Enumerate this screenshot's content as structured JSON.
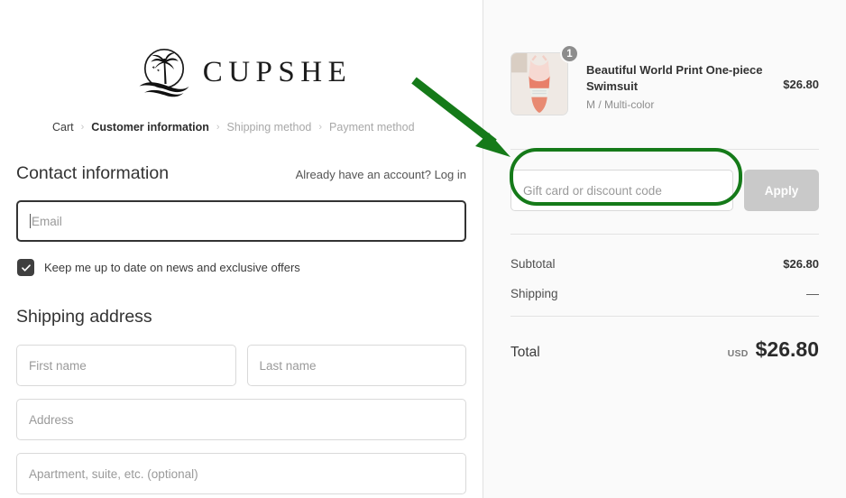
{
  "brand": {
    "name": "CUPSHE",
    "logo_icon": "palm-tree-island-icon"
  },
  "breadcrumb": {
    "items": [
      {
        "label": "Cart",
        "state": "link"
      },
      {
        "label": "Customer information",
        "state": "current"
      },
      {
        "label": "Shipping method",
        "state": "upcoming"
      },
      {
        "label": "Payment method",
        "state": "upcoming"
      }
    ],
    "separator": "›"
  },
  "contact": {
    "title": "Contact information",
    "account_prompt": "Already have an account?",
    "login_label": "Log in",
    "email": {
      "value": "",
      "placeholder": "Email",
      "focused": true
    },
    "newsletter": {
      "label": "Keep me up to date on news and exclusive offers",
      "checked": true,
      "icon": "checkmark-icon"
    }
  },
  "shipping_address": {
    "title": "Shipping address",
    "fields": [
      {
        "name": "first-name",
        "value": "",
        "placeholder": "First name"
      },
      {
        "name": "last-name",
        "value": "",
        "placeholder": "Last name"
      },
      {
        "name": "address",
        "value": "",
        "placeholder": "Address"
      },
      {
        "name": "apartment",
        "value": "",
        "placeholder": "Apartment, suite, etc. (optional)"
      }
    ]
  },
  "order_summary": {
    "product": {
      "title": "Beautiful World Print One-piece Swimsuit",
      "variant": "M / Multi-color",
      "price": "$26.80",
      "quantity": "1",
      "image_icon": "swimsuit-thumbnail"
    },
    "discount": {
      "input_value": "",
      "input_placeholder": "Gift card or discount code",
      "apply_label": "Apply",
      "apply_disabled": true
    },
    "lines": [
      {
        "label": "Subtotal",
        "value": "$26.80"
      },
      {
        "label": "Shipping",
        "value": "—"
      }
    ],
    "total": {
      "label": "Total",
      "currency": "USD",
      "amount": "$26.80"
    }
  },
  "annotation": {
    "color": "#157a19",
    "arrow": "arrow-pointing-to-discount-field",
    "highlight": "rounded-rect-around-discount-input"
  },
  "colors": {
    "accent_green": "#157a19",
    "panel_bg": "#fafafa",
    "border": "#d9d9d9",
    "text_dark": "#333333",
    "text_muted": "#9a9a9a",
    "apply_disabled": "#c9c9c9",
    "checkbox_fill": "#3f3f3f"
  }
}
